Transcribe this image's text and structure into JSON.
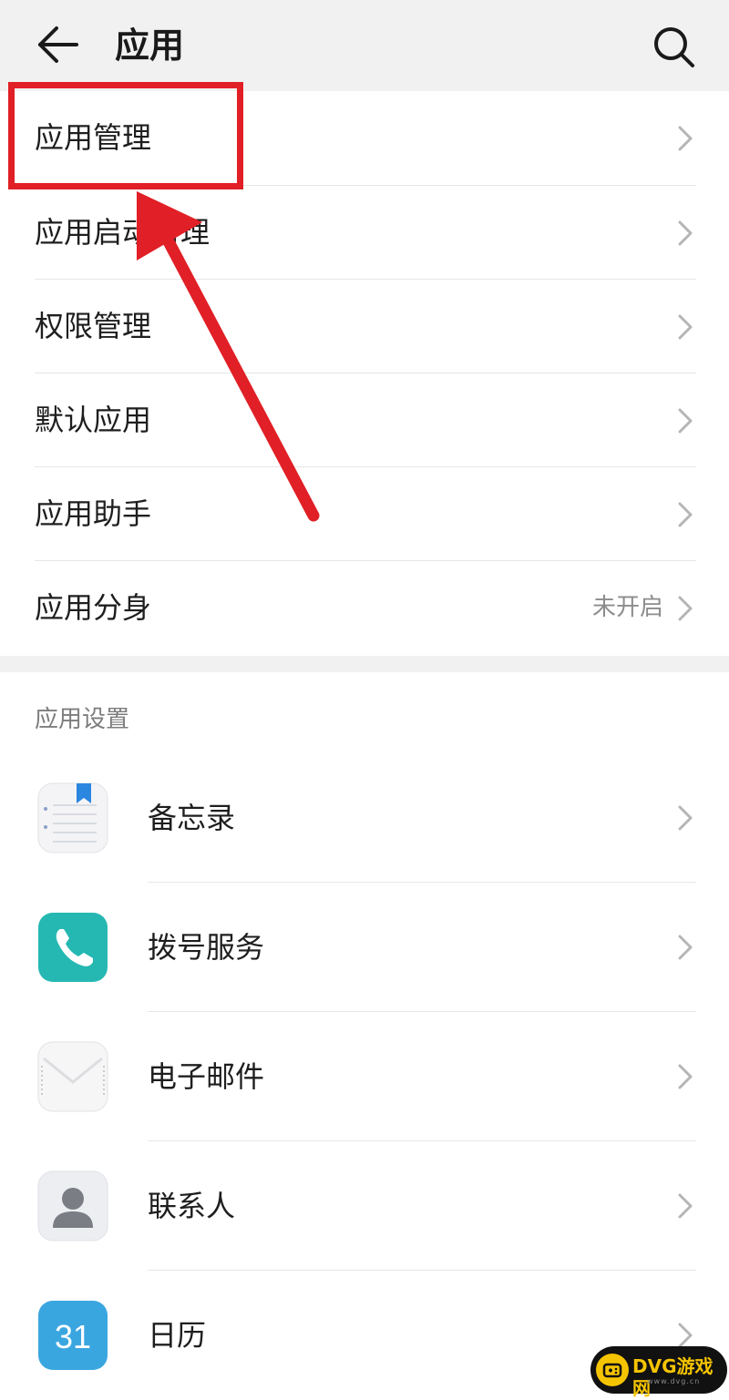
{
  "header": {
    "title": "应用",
    "back_icon": "arrow-left-icon",
    "search_icon": "search-icon"
  },
  "menu": {
    "items": [
      {
        "label": "应用管理",
        "value": ""
      },
      {
        "label": "应用启动管理",
        "value": ""
      },
      {
        "label": "权限管理",
        "value": ""
      },
      {
        "label": "默认应用",
        "value": ""
      },
      {
        "label": "应用助手",
        "value": ""
      },
      {
        "label": "应用分身",
        "value": "未开启"
      }
    ]
  },
  "app_settings": {
    "header": "应用设置",
    "apps": [
      {
        "name": "备忘录",
        "icon": "notepad-icon"
      },
      {
        "name": "拨号服务",
        "icon": "phone-icon"
      },
      {
        "name": "电子邮件",
        "icon": "mail-icon"
      },
      {
        "name": "联系人",
        "icon": "contact-icon"
      },
      {
        "name": "日历",
        "icon": "calendar-icon",
        "icon_text": "31"
      }
    ]
  },
  "annotation": {
    "color": "#e11f26"
  },
  "watermark": {
    "text": "DVG游戏网",
    "sub": "www.dvg.cn"
  },
  "colors": {
    "header_bg": "#f1f1f1",
    "phone_teal": "#25b8b2",
    "calendar_blue": "#3aa6e0",
    "annotation_red": "#e11f26"
  }
}
